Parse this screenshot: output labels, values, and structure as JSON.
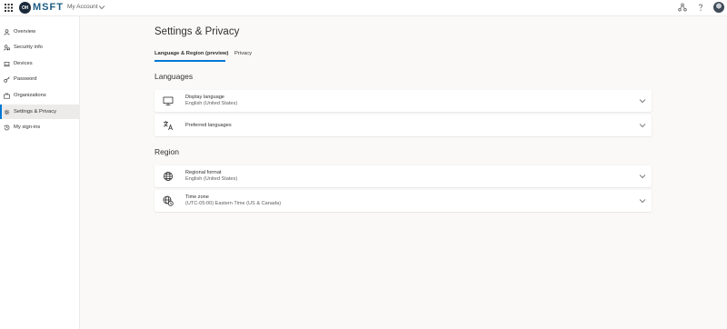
{
  "header": {
    "logo_badge": "OH",
    "logo_text": "MSFT",
    "app_name": "My Account",
    "icons": [
      "waffle-icon",
      "chevron-down-icon",
      "network-icon",
      "help-icon",
      "avatar"
    ]
  },
  "sidebar": {
    "items": [
      {
        "label": "Overview",
        "icon": "person-icon",
        "active": false
      },
      {
        "label": "Security info",
        "icon": "security-info-icon",
        "active": false
      },
      {
        "label": "Devices",
        "icon": "laptop-icon",
        "active": false
      },
      {
        "label": "Password",
        "icon": "key-icon",
        "active": false
      },
      {
        "label": "Organizations",
        "icon": "briefcase-icon",
        "active": false
      },
      {
        "label": "Settings & Privacy",
        "icon": "gear-icon",
        "active": true
      },
      {
        "label": "My sign-ins",
        "icon": "history-icon",
        "active": false
      }
    ]
  },
  "main": {
    "title": "Settings & Privacy",
    "tabs": [
      {
        "label": "Language & Region (preview)",
        "active": true
      },
      {
        "label": "Privacy",
        "active": false
      }
    ],
    "languages": {
      "title": "Languages",
      "cards": [
        {
          "title": "Display language",
          "value": "English (United States)",
          "icon": "monitor-icon"
        },
        {
          "title": "Preferred languages",
          "value": "",
          "icon": "translate-icon"
        }
      ]
    },
    "region": {
      "title": "Region",
      "cards": [
        {
          "title": "Regional format",
          "value": "English (United States)",
          "icon": "globe-icon"
        },
        {
          "title": "Time zone",
          "value": "(UTC-05:00) Eastern Time (US & Canada)",
          "icon": "globe-clock-icon"
        }
      ]
    }
  },
  "colors": {
    "accent": "#0078d4",
    "brand_logo": "#1e5d85",
    "background": "#faf9f8"
  }
}
